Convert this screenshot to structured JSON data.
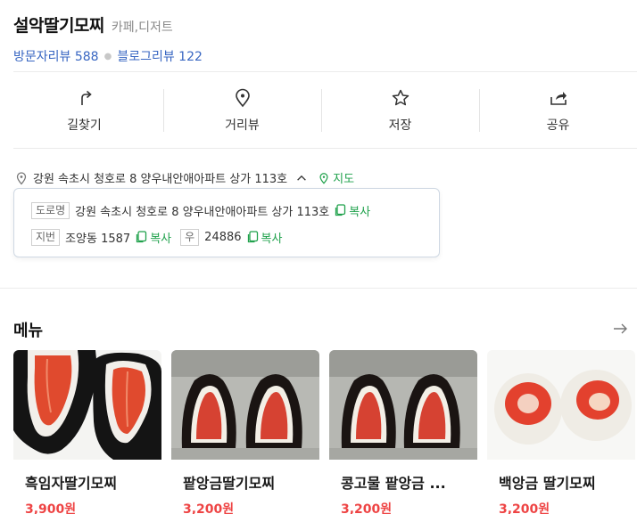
{
  "place": {
    "name": "설악딸기모찌",
    "category": "카페,디저트",
    "visitor_review_label": "방문자리뷰 588",
    "blog_review_label": "블로그리뷰 122"
  },
  "actions": [
    {
      "label": "길찾기",
      "icon": "directions-icon"
    },
    {
      "label": "거리뷰",
      "icon": "map-pin-icon"
    },
    {
      "label": "저장",
      "icon": "star-icon"
    },
    {
      "label": "공유",
      "icon": "share-icon"
    }
  ],
  "address": {
    "summary": "강원 속초시 청호로 8 양우내안애아파트 상가 113호",
    "map_label": "지도",
    "popup": {
      "road_tag": "도로명",
      "road_address": "강원 속초시 청호로 8 양우내안애아파트 상가 113호",
      "lot_tag": "지번",
      "lot_address": "조양동 1587",
      "zip_tag": "우",
      "zip_code": "24886",
      "copy_label": "복사"
    }
  },
  "menu": {
    "title": "메뉴",
    "items": [
      {
        "name": "흑임자딸기모찌",
        "price": "3,900원"
      },
      {
        "name": "팥앙금딸기모찌",
        "price": "3,200원"
      },
      {
        "name": "콩고물 팥앙금 ...",
        "price": "3,200원"
      },
      {
        "name": "백앙금 딸기모찌",
        "price": "3,200원"
      }
    ]
  },
  "colors": {
    "link_blue": "#3866c2",
    "accent_green": "#1fa14b",
    "price_red": "#e44444"
  }
}
